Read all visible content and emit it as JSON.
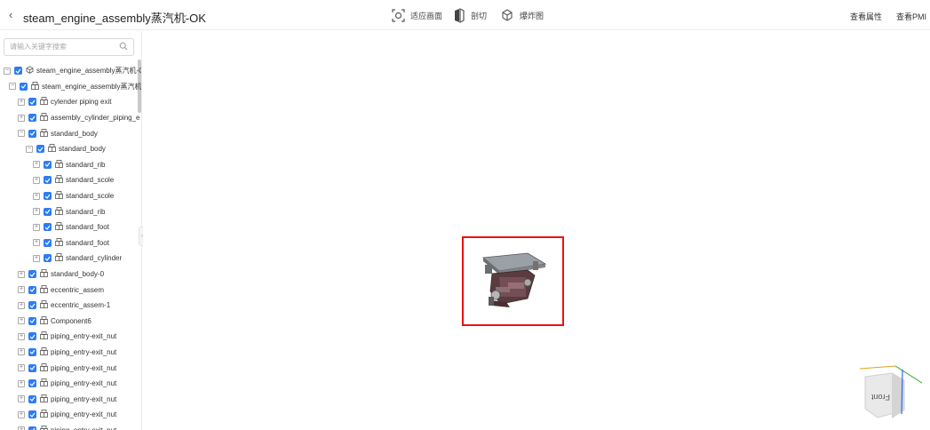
{
  "header": {
    "back_icon": "chevron-left-icon",
    "title": "steam_engine_assembly蒸汽机-OK",
    "title_dropdown_icon": "chevron-down-icon",
    "tools": [
      {
        "label": "适应画面",
        "icon": "fit-view-icon"
      },
      {
        "label": "剖切",
        "icon": "section-cut-icon"
      },
      {
        "label": "爆炸图",
        "icon": "explode-icon"
      }
    ],
    "right_links": [
      "查看属性",
      "查看PMI"
    ]
  },
  "sidebar": {
    "search_placeholder": "请输入关键字搜索",
    "tree": [
      {
        "label": "steam_engine_assembly蒸汽机-OK",
        "level": 0,
        "expanded": true,
        "icon": "assembly-root-icon"
      },
      {
        "label": "steam_engine_assembly蒸汽机",
        "level": 1,
        "expanded": true,
        "icon": "assembly-icon"
      },
      {
        "label": "cylender piping exit",
        "level": 2,
        "expanded": false,
        "icon": "assembly-icon"
      },
      {
        "label": "assembly_cylinder_piping_e",
        "level": 2,
        "expanded": false,
        "icon": "assembly-icon"
      },
      {
        "label": "standard_body",
        "level": 2,
        "expanded": true,
        "icon": "assembly-icon"
      },
      {
        "label": "standard_body",
        "level": 3,
        "expanded": true,
        "icon": "assembly-icon"
      },
      {
        "label": "standard_rib",
        "level": 4,
        "expanded": false,
        "icon": "assembly-icon"
      },
      {
        "label": "standard_scole",
        "level": 4,
        "expanded": false,
        "icon": "assembly-icon"
      },
      {
        "label": "standard_scole",
        "level": 4,
        "expanded": false,
        "icon": "assembly-icon"
      },
      {
        "label": "standard_rib",
        "level": 4,
        "expanded": false,
        "icon": "assembly-icon"
      },
      {
        "label": "standard_foot",
        "level": 4,
        "expanded": false,
        "icon": "assembly-icon"
      },
      {
        "label": "standard_foot",
        "level": 4,
        "expanded": false,
        "icon": "assembly-icon"
      },
      {
        "label": "standard_cylinder",
        "level": 4,
        "expanded": false,
        "icon": "assembly-icon"
      },
      {
        "label": "standard_body-0",
        "level": 2,
        "expanded": false,
        "icon": "assembly-icon"
      },
      {
        "label": "eccentric_assem",
        "level": 2,
        "expanded": false,
        "icon": "assembly-icon"
      },
      {
        "label": "eccentric_assem-1",
        "level": 2,
        "expanded": false,
        "icon": "assembly-icon"
      },
      {
        "label": "Component6",
        "level": 2,
        "expanded": false,
        "icon": "assembly-icon"
      },
      {
        "label": "piping_entry-exit_nut",
        "level": 2,
        "expanded": false,
        "icon": "assembly-icon"
      },
      {
        "label": "piping_entry-exit_nut",
        "level": 2,
        "expanded": false,
        "icon": "assembly-icon"
      },
      {
        "label": "piping_entry-exit_nut",
        "level": 2,
        "expanded": false,
        "icon": "assembly-icon"
      },
      {
        "label": "piping_entry-exit_nut",
        "level": 2,
        "expanded": false,
        "icon": "assembly-icon"
      },
      {
        "label": "piping_entry-exit_nut",
        "level": 2,
        "expanded": false,
        "icon": "assembly-icon"
      },
      {
        "label": "piping_entry-exit_nut",
        "level": 2,
        "expanded": false,
        "icon": "assembly-icon"
      },
      {
        "label": "piping_entry-exit_nut",
        "level": 2,
        "expanded": false,
        "icon": "assembly-icon"
      }
    ]
  },
  "viewport": {
    "model_name": "steam engine model",
    "view_cube_face": "Front",
    "selection_color": "#e11111",
    "accent_color": "#2b7cf6"
  }
}
